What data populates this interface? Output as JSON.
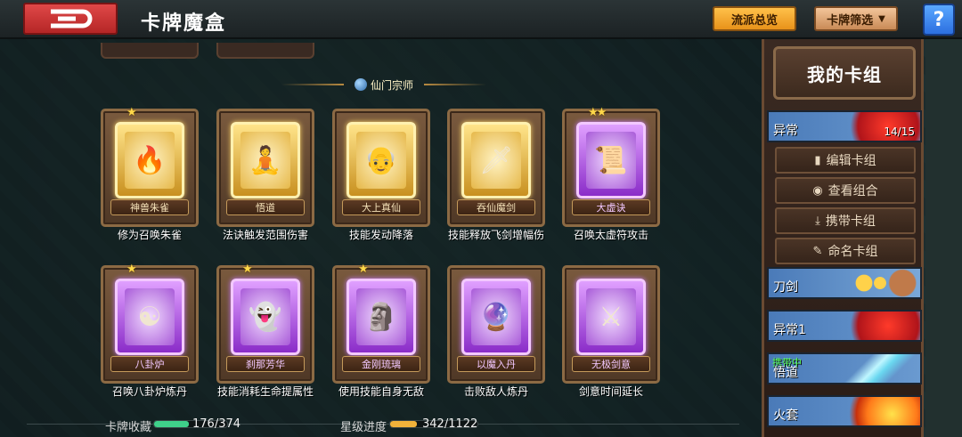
{
  "header": {
    "title": "卡牌魔盒",
    "overview_label": "流派总览",
    "filter_label": "卡牌筛选",
    "help_label": "?"
  },
  "section": {
    "title": "仙门宗师"
  },
  "cards": [
    {
      "name": "神兽朱雀",
      "desc": "修为召唤朱雀",
      "rarity": "gold",
      "stars": "★",
      "icon": "phoenix-icon",
      "glyph": "🔥"
    },
    {
      "name": "悟道",
      "desc": "法诀触发范围伤害",
      "rarity": "gold",
      "stars": "",
      "icon": "meditator-icon",
      "glyph": "🧘"
    },
    {
      "name": "大上真仙",
      "desc": "技能发动降落",
      "rarity": "gold",
      "stars": "",
      "icon": "immortal-icon",
      "glyph": "👴"
    },
    {
      "name": "吞仙魔剑",
      "desc": "技能释放飞剑增幅伤",
      "rarity": "gold",
      "stars": "",
      "icon": "demon-sword-icon",
      "glyph": "🗡"
    },
    {
      "name": "大虚诀",
      "desc": "召唤太虚符攻击",
      "rarity": "purple",
      "stars": "★★",
      "icon": "talisman-icon",
      "glyph": "📜"
    },
    {
      "name": "八卦炉",
      "desc": "召唤八卦炉炼丹",
      "rarity": "purple",
      "stars": "★",
      "icon": "furnace-icon",
      "glyph": "☯"
    },
    {
      "name": "刹那芳华",
      "desc": "技能消耗生命提属性",
      "rarity": "purple",
      "stars": "★",
      "icon": "spirit-icon",
      "glyph": "👻"
    },
    {
      "name": "金刚琉璃",
      "desc": "使用技能自身无敌",
      "rarity": "purple",
      "stars": "★",
      "icon": "buddha-icon",
      "glyph": "🗿"
    },
    {
      "name": "以魔入丹",
      "desc": "击败敌人炼丹",
      "rarity": "purple",
      "stars": "",
      "icon": "crystal-orb-icon",
      "glyph": "🔮"
    },
    {
      "name": "无极剑意",
      "desc": "剑意时间延长",
      "rarity": "purple",
      "stars": "",
      "icon": "sword-intent-icon",
      "glyph": "⚔"
    }
  ],
  "stats": {
    "collection_label": "卡牌收藏",
    "collection_value": "176/374",
    "collection_fraction": 0.47,
    "star_label": "星级进度",
    "star_value": "342/1122",
    "star_fraction": 0.305
  },
  "panel": {
    "title": "我的卡组",
    "current_deck": {
      "name": "异常",
      "count": "14/15"
    },
    "actions": [
      {
        "label": "编辑卡组",
        "icon": "card-icon",
        "glyph": "▮"
      },
      {
        "label": "查看组合",
        "icon": "eye-icon",
        "glyph": "◉"
      },
      {
        "label": "携带卡组",
        "icon": "download-icon",
        "glyph": "⤓"
      },
      {
        "label": "命名卡组",
        "icon": "pencil-icon",
        "glyph": "✎"
      }
    ],
    "decks": [
      {
        "name": "刀剑",
        "carry": ""
      },
      {
        "name": "异常1",
        "carry": ""
      },
      {
        "name": "悟道",
        "carry": "携带中"
      },
      {
        "name": "火套",
        "carry": ""
      }
    ]
  },
  "colors": {
    "gold_frame": "#e6b84a",
    "purple_frame": "#a85ad8",
    "collection_bar": "#3fd08a",
    "star_bar": "#f2b23a",
    "carry_text": "#5cff5c"
  }
}
